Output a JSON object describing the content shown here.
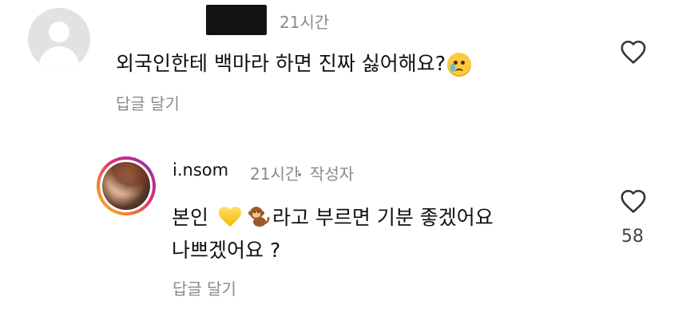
{
  "comments": [
    {
      "author_redacted": true,
      "time": "21시간",
      "text": "외국인한테 백마라 하면 진짜 싫어해요?",
      "emoji_icon": "crying-face-icon",
      "reply_label": "답글 달기",
      "like_icon": "heart-outline-icon"
    },
    {
      "username": "i.nsom",
      "time": "21시간",
      "separator": "•",
      "badge": "작성자",
      "text_prefix": "본인 ",
      "emoji_1": "yellow-heart-icon",
      "emoji_2": "monkey-icon",
      "text_suffix": "라고 부르면 기분 좋겠어요",
      "text_line2": "나쁘겠어요 ?",
      "reply_label": "답글 달기",
      "like_icon": "heart-outline-icon",
      "like_count": "58"
    }
  ],
  "colors": {
    "text": "#111111",
    "muted": "#8a8a8a",
    "avatar_default": "#e2e2e2"
  }
}
